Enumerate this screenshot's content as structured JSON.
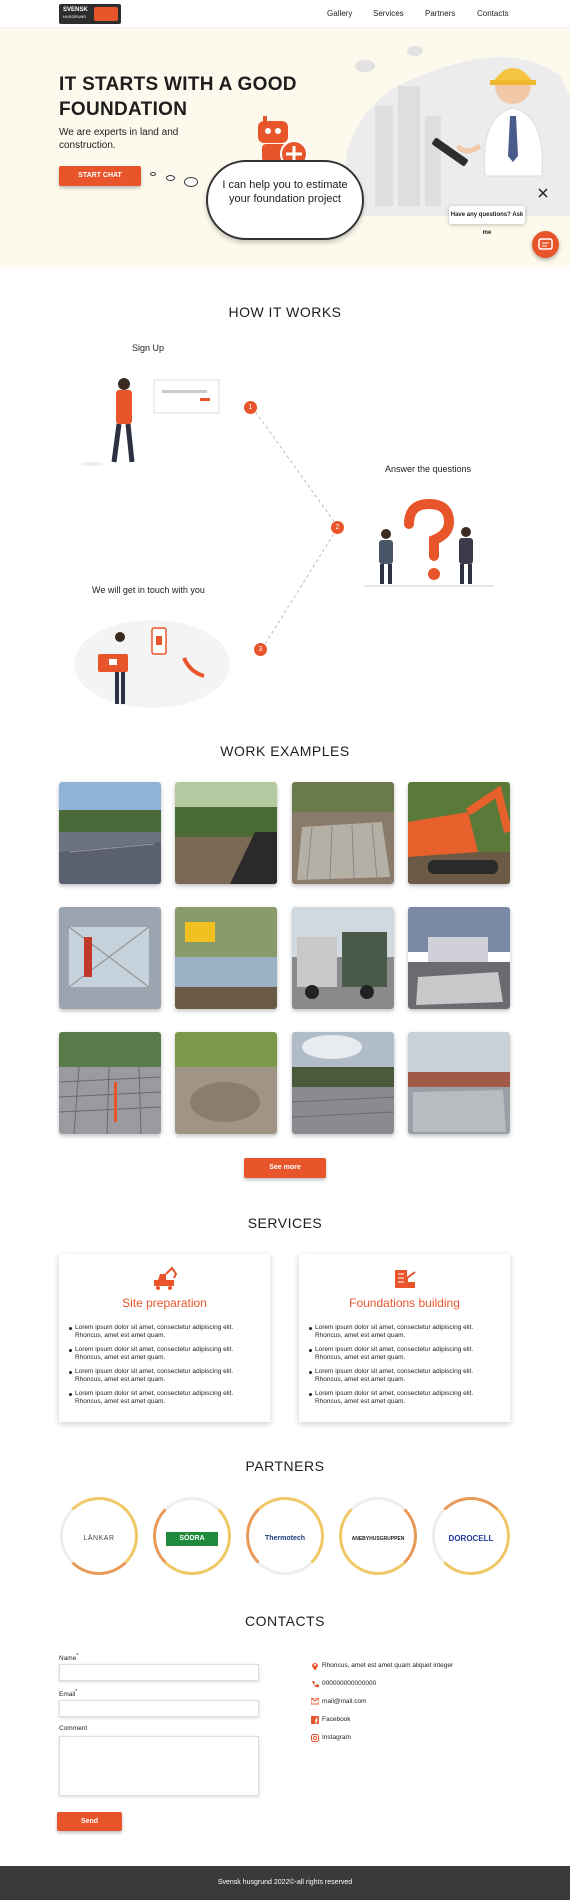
{
  "nav": {
    "logo_line1": "SVENSK",
    "logo_line2": "HUSGRUND",
    "links": [
      "Gallery",
      "Services",
      "Partners",
      "Contacts"
    ]
  },
  "hero": {
    "title": "IT STARTS WITH A GOOD FOUNDATION",
    "subtitle": "We are experts in land and construction.",
    "cta": "START CHAT",
    "bubble": "I can help you to estimate your foundation project",
    "chat_prompt": "Have any questions? Ask me"
  },
  "how": {
    "title": "HOW IT WORKS",
    "steps": [
      {
        "num": "1",
        "label": "Sign Up"
      },
      {
        "num": "2",
        "label": "Answer the questions"
      },
      {
        "num": "3",
        "label": "We will get in touch with you"
      }
    ]
  },
  "work": {
    "title": "WORK EXAMPLES",
    "see_more": "See more"
  },
  "services": {
    "title": "SERVICES",
    "cards": [
      {
        "title": "Site preparation",
        "items": [
          "Lorem ipsum dolor sit amet, consectetur adipiscing elit. Rhoncus, amet est amet quam.",
          "Lorem ipsum dolor sit amet, consectetur adipiscing elit. Rhoncus, amet est amet quam.",
          "Lorem ipsum dolor sit amet, consectetur adipiscing elit. Rhoncus, amet est amet quam.",
          "Lorem ipsum dolor sit amet, consectetur adipiscing elit. Rhoncus, amet est amet quam."
        ]
      },
      {
        "title": "Foundations building",
        "items": [
          "Lorem ipsum dolor sit amet, consectetur adipiscing elit. Rhoncus, amet est amet quam.",
          "Lorem ipsum dolor sit amet, consectetur adipiscing elit. Rhoncus, amet est amet quam.",
          "Lorem ipsum dolor sit amet, consectetur adipiscing elit. Rhoncus, amet est amet quam.",
          "Lorem ipsum dolor sit amet, consectetur adipiscing elit. Rhoncus, amet est amet quam."
        ]
      }
    ]
  },
  "partners": {
    "title": "PARTNERS",
    "items": [
      "LÄNKAR",
      "SÖDRA",
      "Thermotech",
      "ANEBYHUSGRUPPEN",
      "DOROCELL"
    ]
  },
  "contacts": {
    "title": "CONTACTS",
    "name_label": "Name",
    "email_label": "Email",
    "comment_label": "Comment",
    "required_mark": "*",
    "send": "Send",
    "address": "Rhoncus, amet est amet quam aliquet integer",
    "phone": "000000000000000",
    "email": "mail@mail.com",
    "facebook": "Facebook",
    "instagram": "Instagram"
  },
  "footer": {
    "text": "Svensk husgrund 2022©-all rights reserved"
  },
  "colors": {
    "accent": "#e8552b",
    "hero_bg": "#fdf9ec",
    "footer_bg": "#3a3a3a",
    "partner_ring": "#f1c866"
  }
}
